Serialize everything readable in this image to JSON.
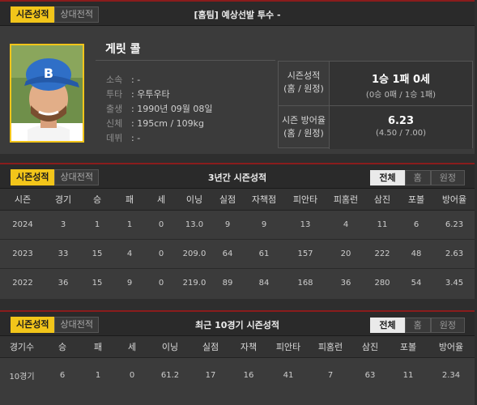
{
  "profile": {
    "tabs": [
      "시즌성적",
      "상대전적"
    ],
    "title": "[홈팀] 예상선발 투수 -",
    "name": "게릿 콜",
    "info": [
      {
        "k": "소속",
        "v": ": -"
      },
      {
        "k": "투타",
        "v": ": 우투우타"
      },
      {
        "k": "출생",
        "v": ": 1990년 09월 08일"
      },
      {
        "k": "신체",
        "v": ": 195cm / 109kg"
      },
      {
        "k": "데뷔",
        "v": ": -"
      }
    ],
    "stats": {
      "season_label_1": "시즌성적",
      "season_label_2": "(홈 / 원정)",
      "season_value": "1승 1패 0세",
      "season_sub": "(0승 0패 / 1승 1패)",
      "era_label_1": "시즌 방어율",
      "era_label_2": "(홈 / 원정)",
      "era_value": "6.23",
      "era_sub": "(4.50 / 7.00)"
    }
  },
  "three_year": {
    "tabs": [
      "시즌성적",
      "상대전적"
    ],
    "title": "3년간 시즌성적",
    "filters": [
      "전체",
      "홈",
      "원정"
    ],
    "columns": [
      "시즌",
      "경기",
      "승",
      "패",
      "세",
      "이닝",
      "실점",
      "자책점",
      "피안타",
      "피홈런",
      "삼진",
      "포볼",
      "방어율"
    ],
    "rows": [
      [
        "2024",
        "3",
        "1",
        "1",
        "0",
        "13.0",
        "9",
        "9",
        "13",
        "4",
        "11",
        "6",
        "6.23"
      ],
      [
        "2023",
        "33",
        "15",
        "4",
        "0",
        "209.0",
        "64",
        "61",
        "157",
        "20",
        "222",
        "48",
        "2.63"
      ],
      [
        "2022",
        "36",
        "15",
        "9",
        "0",
        "219.0",
        "89",
        "84",
        "168",
        "36",
        "280",
        "54",
        "3.45"
      ]
    ]
  },
  "recent": {
    "tabs": [
      "시즌성적",
      "상대전적"
    ],
    "title": "최근 10경기 시즌성적",
    "filters": [
      "전체",
      "홈",
      "원정"
    ],
    "columns": [
      "경기수",
      "승",
      "패",
      "세",
      "이닝",
      "실점",
      "자책",
      "피안타",
      "피홈런",
      "삼진",
      "포볼",
      "방어율"
    ],
    "rows": [
      [
        "10경기",
        "6",
        "1",
        "0",
        "61.2",
        "17",
        "16",
        "41",
        "7",
        "63",
        "11",
        "2.34"
      ]
    ]
  },
  "colors": {
    "accent": "#f2c51a",
    "divider": "#8a1c1c"
  }
}
